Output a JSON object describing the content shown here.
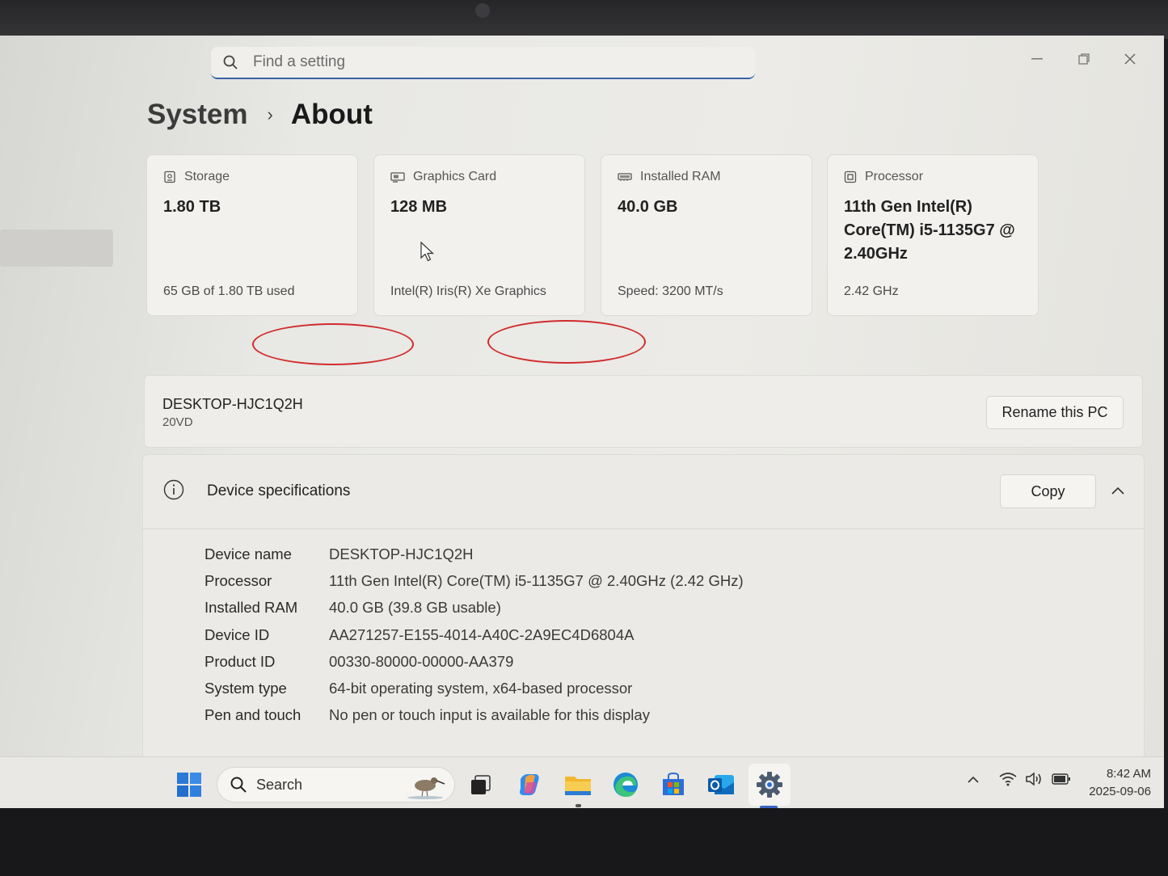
{
  "search": {
    "placeholder": "Find a setting"
  },
  "breadcrumb": {
    "parent": "System",
    "separator": "›",
    "current": "About"
  },
  "cards": [
    {
      "label": "Storage",
      "value": "1.80 TB",
      "sub": "65 GB of 1.80 TB used",
      "icon": "storage-icon"
    },
    {
      "label": "Graphics Card",
      "value": "128 MB",
      "sub": "Intel(R) Iris(R) Xe Graphics",
      "icon": "graphics-card-icon"
    },
    {
      "label": "Installed RAM",
      "value": "40.0 GB",
      "sub": "Speed: 3200 MT/s",
      "icon": "ram-icon"
    },
    {
      "label": "Processor",
      "value": "11th Gen Intel(R) Core(TM) i5-1135G7 @ 2.40GHz",
      "sub": "2.42 GHz",
      "icon": "processor-icon"
    }
  ],
  "pc": {
    "name": "DESKTOP-HJC1Q2H",
    "model": "20VD",
    "rename_label": "Rename this PC"
  },
  "specs": {
    "title": "Device specifications",
    "copy_label": "Copy",
    "rows": [
      {
        "key": "Device name",
        "value": "DESKTOP-HJC1Q2H"
      },
      {
        "key": "Processor",
        "value": "11th Gen Intel(R) Core(TM) i5-1135G7 @ 2.40GHz (2.42 GHz)"
      },
      {
        "key": "Installed RAM",
        "value": "40.0 GB (39.8 GB usable)"
      },
      {
        "key": "Device ID",
        "value": "AA271257-E155-4014-A40C-2A9EC4D6804A"
      },
      {
        "key": "Product ID",
        "value": "00330-80000-00000-AA379"
      },
      {
        "key": "System type",
        "value": "64-bit operating system, x64-based processor"
      },
      {
        "key": "Pen and touch",
        "value": "No pen or touch input is available for this display"
      }
    ]
  },
  "taskbar": {
    "search_label": "Search",
    "time": "8:42 AM",
    "date": "2025-09-06"
  },
  "colors": {
    "accent": "#3a63a8",
    "annotation": "#d12c2c"
  }
}
